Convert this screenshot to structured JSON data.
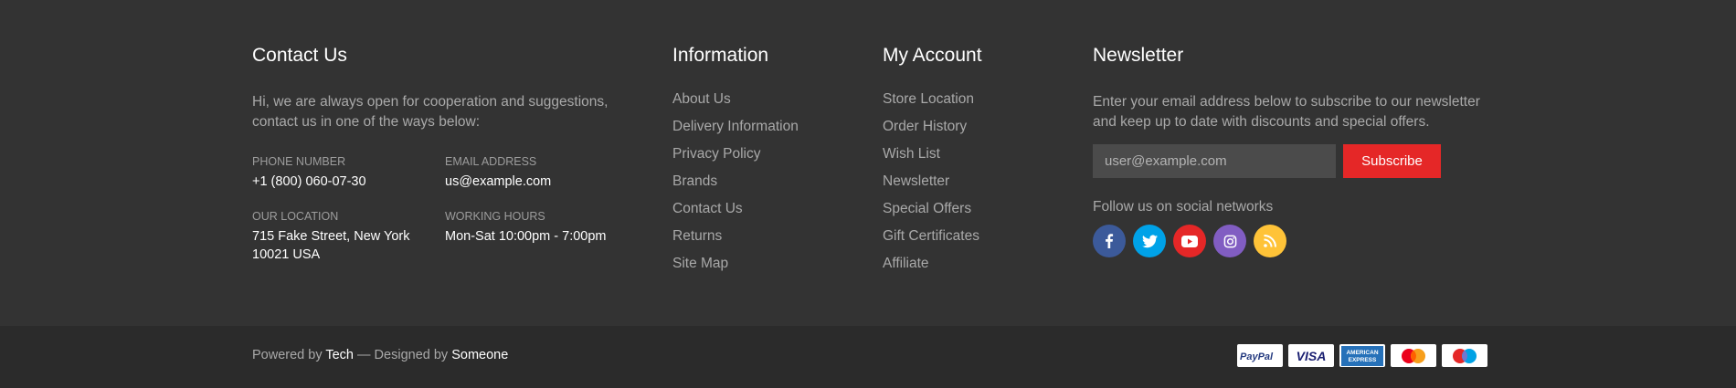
{
  "contact": {
    "title": "Contact Us",
    "intro": "Hi, we are always open for cooperation and suggestions, contact us in one of the ways below:",
    "phone": {
      "label": "Phone Number",
      "value": "+1 (800) 060-07-30"
    },
    "email": {
      "label": "Email Address",
      "value": "us@example.com"
    },
    "location": {
      "label": "Our Location",
      "value": "715 Fake Street, New York 10021 USA"
    },
    "hours": {
      "label": "Working Hours",
      "value": "Mon-Sat 10:00pm - 7:00pm"
    }
  },
  "information": {
    "title": "Information",
    "links": [
      "About Us",
      "Delivery Information",
      "Privacy Policy",
      "Brands",
      "Contact Us",
      "Returns",
      "Site Map"
    ]
  },
  "account": {
    "title": "My Account",
    "links": [
      "Store Location",
      "Order History",
      "Wish List",
      "Newsletter",
      "Special Offers",
      "Gift Certificates",
      "Affiliate"
    ]
  },
  "newsletter": {
    "title": "Newsletter",
    "text": "Enter your email address below to subscribe to our newsletter and keep up to date with discounts and special offers.",
    "input_placeholder": "user@example.com",
    "input_value": "",
    "button_label": "Subscribe",
    "follow_label": "Follow us on social networks",
    "socials": [
      {
        "icon": "facebook-icon",
        "color": "#3c5a9a"
      },
      {
        "icon": "twitter-icon",
        "color": "#00a2e8"
      },
      {
        "icon": "youtube-icon",
        "color": "#e52727"
      },
      {
        "icon": "instagram-icon",
        "color": "#815dc2"
      },
      {
        "icon": "rss-icon",
        "color": "#ffc338"
      }
    ]
  },
  "bottom": {
    "powered_by": "Powered by",
    "tech": "Tech",
    "separator": " — Designed by ",
    "someone": "Someone",
    "payments": [
      "PayPal",
      "VISA",
      "AMERICAN EXPRESS",
      "mastercard",
      "maestro"
    ]
  },
  "colors": {
    "background": "#333333",
    "bottom_background": "#2b2b2b",
    "accent": "#e52727",
    "muted_text": "#a9a9a9"
  }
}
